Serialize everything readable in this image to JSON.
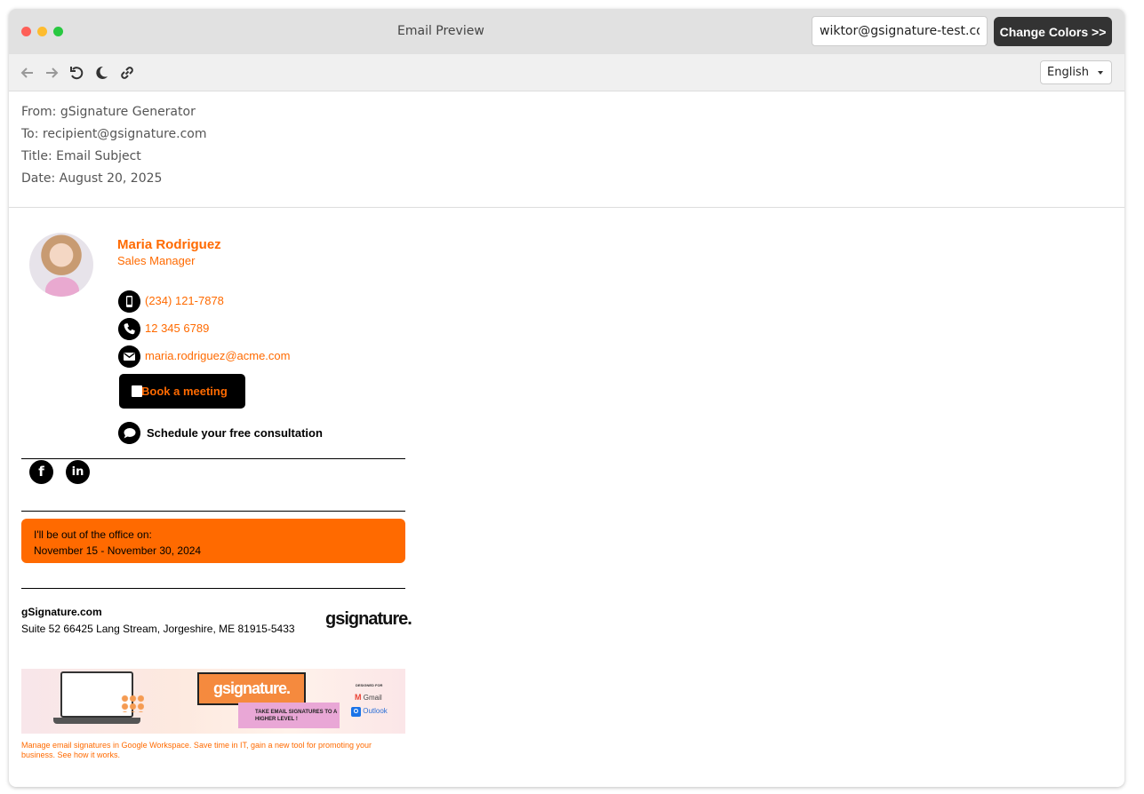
{
  "window": {
    "title": "Email Preview",
    "sender_input_value": "wiktor@gsignature-test.com",
    "change_colors_label": "Change Colors >>",
    "language": "English"
  },
  "toolbar": {
    "icons": [
      "back-arrow-icon",
      "forward-arrow-icon",
      "undo-icon",
      "moon-icon",
      "link-icon"
    ]
  },
  "email_headers": {
    "from": "From: gSignature Generator",
    "to": "To: recipient@gsignature.com",
    "title": "Title: Email Subject",
    "date": "Date: August 20, 2025"
  },
  "signature": {
    "name": "Maria Rodriguez",
    "role": "Sales Manager",
    "mobile": "(234) 121-7878",
    "phone": "12 345 6789",
    "email": "maria.rodriguez@acme.com",
    "book_button": "Book a meeting",
    "schedule_text": "Schedule your free consultation",
    "social": [
      "f",
      "in"
    ],
    "out_of_office_line1": "I'll be out of the office on:",
    "out_of_office_line2": "November 15 - November 30, 2024",
    "company": "gSignature.com",
    "address": "Suite 52 66425 Lang Stream, Jorgeshire, ME 81915-5433",
    "logo": "gsignature.",
    "banner": {
      "brand": "gsignature.",
      "tagline": "TAKE EMAIL SIGNATURES TO A HIGHER LEVEL !",
      "designed_for": "DESIGNED FOR",
      "gmail": "Gmail",
      "outlook": "Outlook"
    },
    "note": "Manage email signatures in Google Workspace. Save time in IT, gain a new tool for promoting your business. See how it works."
  },
  "colors": {
    "accent": "#ff6a00",
    "titlebar": "#e1e1e1",
    "button_dark": "#333333"
  }
}
